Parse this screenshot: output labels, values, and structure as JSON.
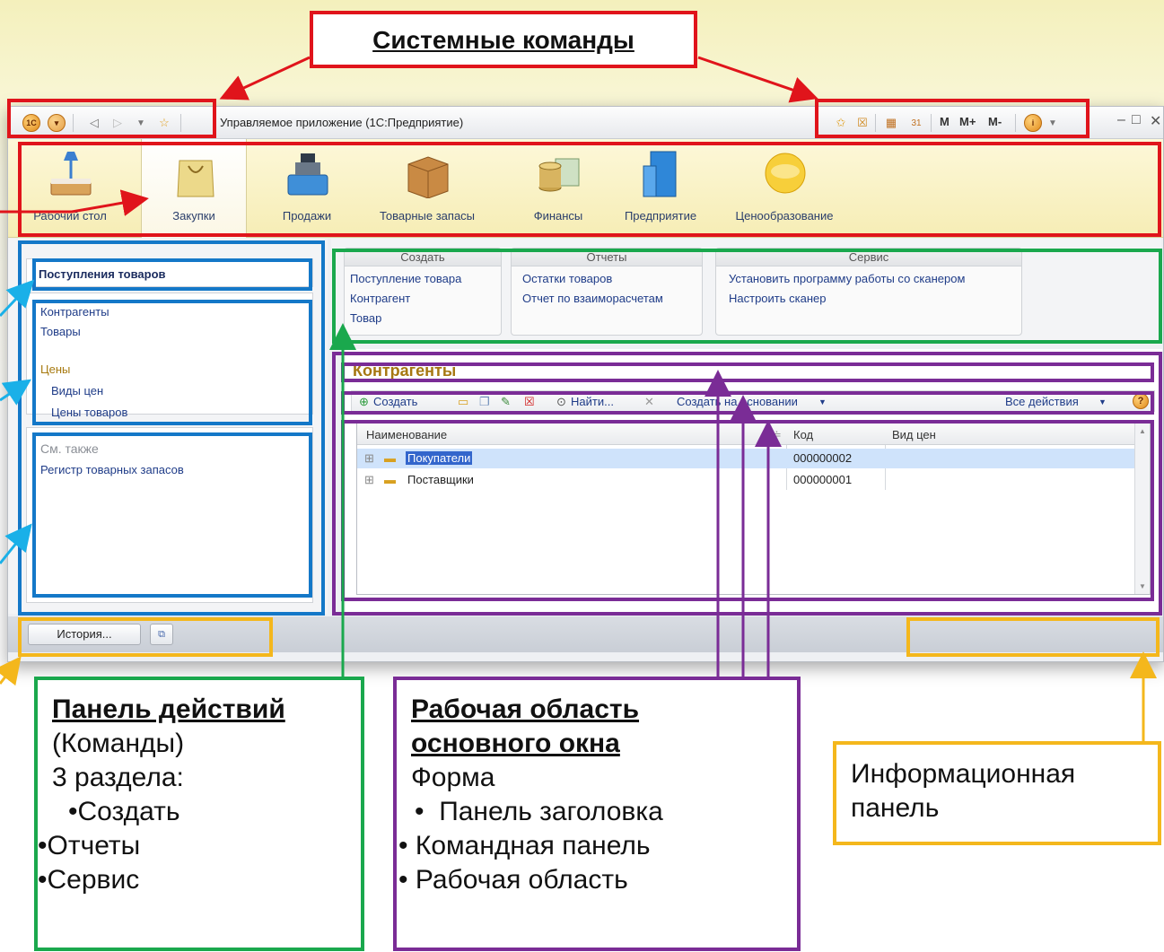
{
  "system_commands_label": "Системные команды",
  "window": {
    "title": "Управляемое приложение  (1С:Предприятие)",
    "right_buttons": [
      "M",
      "M+",
      "M-"
    ]
  },
  "sections": [
    {
      "label": "Рабочий стол",
      "icon": "desk-lamp-icon"
    },
    {
      "label": "Закупки",
      "icon": "shopping-bag-icon"
    },
    {
      "label": "Продажи",
      "icon": "cash-register-icon"
    },
    {
      "label": "Товарные запасы",
      "icon": "box-icon"
    },
    {
      "label": "Финансы",
      "icon": "coins-icon"
    },
    {
      "label": "Предприятие",
      "icon": "building-icon"
    },
    {
      "label": "Ценообразование",
      "icon": "gold-coin-icon"
    }
  ],
  "nav": {
    "main": "Поступления товаров",
    "items": [
      "Контрагенты",
      "Товары"
    ],
    "group_title": "Цены",
    "group_items": [
      "Виды цен",
      "Цены товаров"
    ],
    "see_also_title": "См. также",
    "see_also_items": [
      "Регистр товарных запасов"
    ]
  },
  "actions": {
    "create": {
      "title": "Создать",
      "items": [
        "Поступление товара",
        "Контрагент",
        "Товар"
      ]
    },
    "reports": {
      "title": "Отчеты",
      "items": [
        "Остатки товаров",
        "Отчет по взаиморасчетам"
      ]
    },
    "service": {
      "title": "Сервис",
      "items": [
        "Установить программу работы со сканером",
        "Настроить сканер"
      ]
    }
  },
  "form": {
    "title": "Контрагенты",
    "toolbar": {
      "create": "Создать",
      "find": "Найти...",
      "create_based": "Создать на основании",
      "all_actions": "Все действия"
    },
    "columns": [
      "Наименование",
      "Код",
      "Вид цен"
    ],
    "rows": [
      {
        "name": "Покупатели",
        "code": "000000002",
        "price_type": ""
      },
      {
        "name": "Поставщики",
        "code": "000000001",
        "price_type": ""
      }
    ]
  },
  "bottom": {
    "history_label": "История..."
  },
  "callouts": {
    "actions_panel": {
      "title": "Панель действий",
      "lines": [
        "(Команды)",
        "3 раздела:",
        "•Создать",
        "•Отчеты",
        "•Сервис"
      ]
    },
    "work_area": {
      "title_line1": "Рабочая область",
      "title_line2": "основного окна",
      "lines": [
        "Форма",
        "Панель заголовка",
        "Командная панель",
        "Рабочая область"
      ]
    },
    "info_panel": {
      "lines": [
        "Информационная",
        "панель"
      ]
    }
  },
  "colors": {
    "red": "#e0141b",
    "blue": "#1478c8",
    "green": "#1aa84d",
    "purple": "#7a2c96",
    "yellow": "#f4b71c"
  }
}
